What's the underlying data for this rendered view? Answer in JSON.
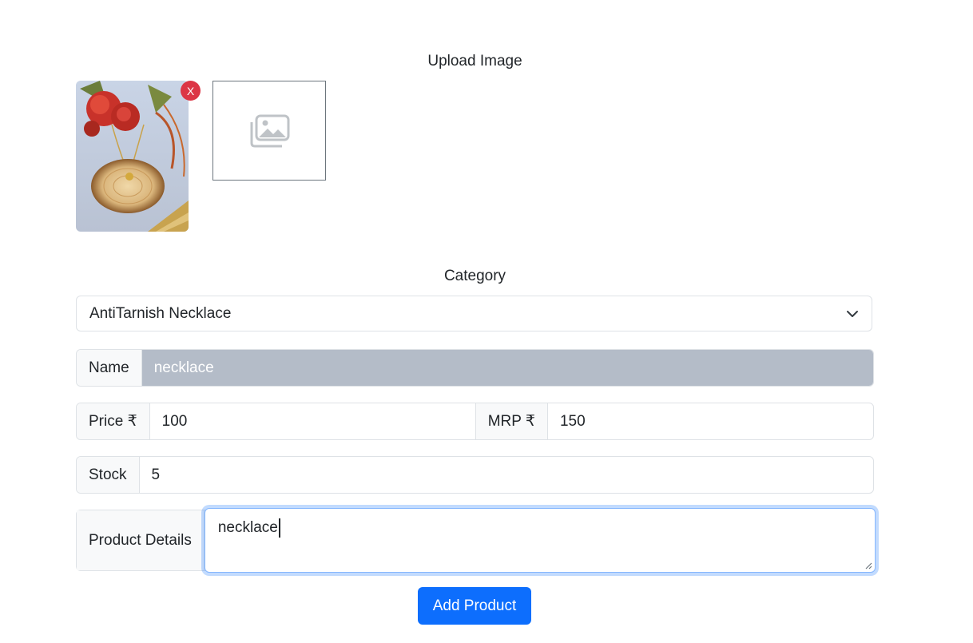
{
  "upload": {
    "title": "Upload Image",
    "remove_label": "X",
    "thumbnail_icon": "product-photo",
    "placeholder_icon": "image-placeholder-icon"
  },
  "category": {
    "title": "Category",
    "selected": "AntiTarnish Necklace"
  },
  "name": {
    "label": "Name",
    "value": "necklace"
  },
  "price": {
    "label": "Price ₹",
    "value": "100"
  },
  "mrp": {
    "label": "MRP ₹",
    "value": "150"
  },
  "stock": {
    "label": "Stock",
    "value": "5"
  },
  "details": {
    "label": "Product Details",
    "value": "necklace"
  },
  "submit": {
    "label": "Add Product"
  },
  "colors": {
    "primary": "#0d6efd",
    "danger": "#dc3545",
    "disabled_field": "#b4bcc8"
  }
}
